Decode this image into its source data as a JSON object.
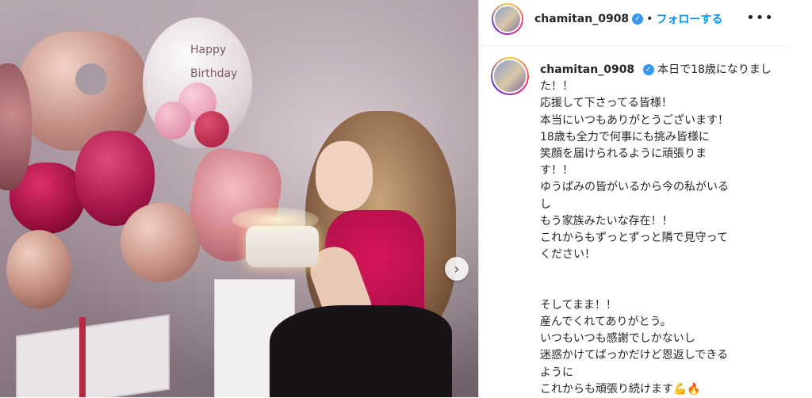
{
  "post": {
    "username": "chamitan_0908",
    "follow_label": "フォローする",
    "more_icon": "more-horizontal-icon",
    "verified_icon": "verified-badge-icon",
    "next_icon": "chevron-right-icon",
    "caption": "本日で18歳になりました！！\n応援して下さってる皆様！\n本当にいつもありがとうございます！\n18歳も全力で何事にも挑み皆様に\n笑顔を届けられるように頑張りま\nす！！\nゆうぱみの皆がいるから今の私がいる\nし\nもう家族みたいな存在！！\nこれからもずっとずっと隣で見守って\nください！\n\n\nそしてまま！！\n産んでくれてありがとう。\nいつもいつも感謝でしかないし\n迷惑かけてばっかだけど恩返しできる\nように\nこれからも頑張り続けます💪🔥",
    "photo_balloon_text": "Happy Birthday"
  },
  "colors": {
    "link_blue": "#0095f6",
    "verified_blue": "#3897f0",
    "text": "#262626"
  }
}
